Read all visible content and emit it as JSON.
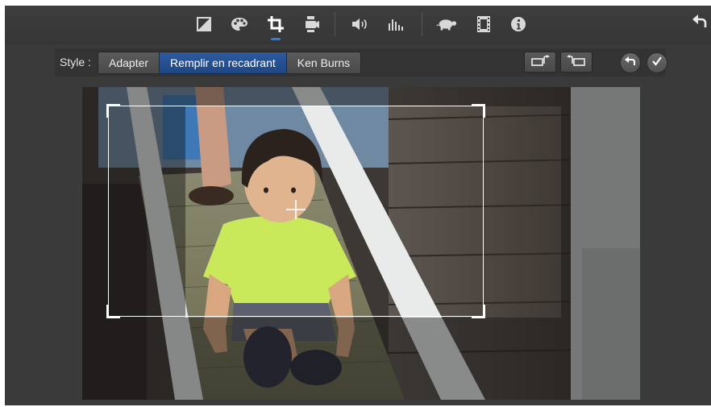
{
  "toolbar": {
    "icons": [
      {
        "name": "color-balance-icon",
        "active": false
      },
      {
        "name": "color-correction-palette-icon",
        "active": false
      },
      {
        "name": "crop-icon",
        "active": true
      },
      {
        "name": "stabilization-camera-icon",
        "active": false
      },
      {
        "name": "volume-icon",
        "active": false
      },
      {
        "name": "equalizer-icon",
        "active": false
      },
      {
        "name": "speed-turtle-icon",
        "active": false
      },
      {
        "name": "video-filter-icon",
        "active": false
      },
      {
        "name": "info-icon",
        "active": false
      }
    ],
    "accent_color": "#2f7ce6"
  },
  "stylebar": {
    "label": "Style :",
    "options": [
      "Adapter",
      "Remplir en recadrant",
      "Ken Burns"
    ],
    "selected": "Remplir en recadrant",
    "selected_color": "#244f8f"
  },
  "actions": {
    "rotate_left_icon": "rotate-left-icon",
    "rotate_right_icon": "rotate-right-icon",
    "reset_icon": "reset-icon",
    "apply_icon": "checkmark-icon",
    "back_icon": "back-arrow-icon"
  }
}
